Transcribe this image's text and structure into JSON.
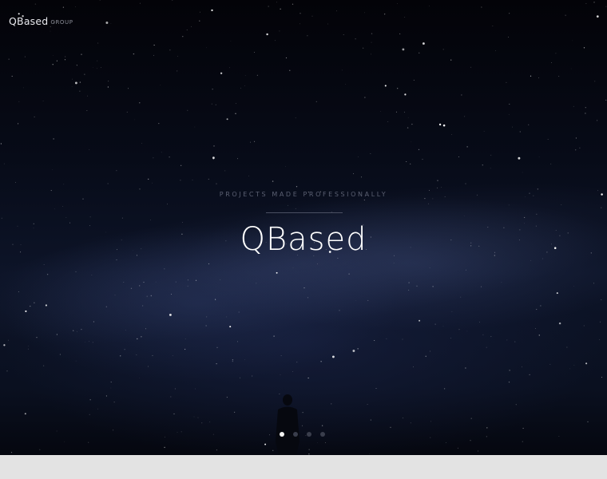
{
  "brand": {
    "name": "QBased",
    "suffix": "GROUP"
  },
  "hero": {
    "tagline": "PROJECTS MADE PROFESSIONALLY",
    "title": "QBased"
  },
  "slider": {
    "slide_count": 4,
    "active_index": 0
  },
  "colors": {
    "sky_dark": "#030308",
    "sky_mid": "#0d1428",
    "title_text": "#ffffff",
    "tagline_text": "#5b6072",
    "dot_active": "#f2f2f2",
    "dot_inactive": "#3a3e4c",
    "footer_band": "#e3e3e3"
  }
}
